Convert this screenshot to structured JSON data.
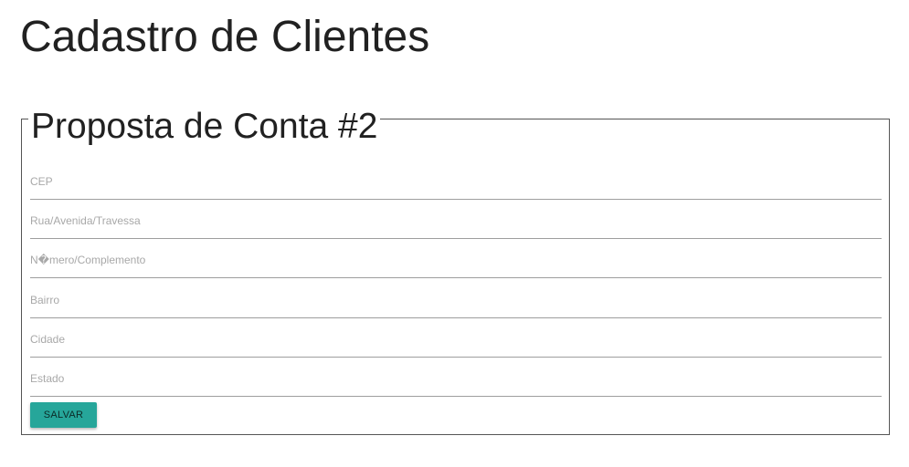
{
  "page": {
    "title": "Cadastro de Clientes"
  },
  "form": {
    "legend": "Proposta de Conta #2",
    "fields": [
      {
        "placeholder": "CEP",
        "value": ""
      },
      {
        "placeholder": "Rua/Avenida/Travessa",
        "value": ""
      },
      {
        "placeholder": "N�mero/Complemento",
        "value": ""
      },
      {
        "placeholder": "Bairro",
        "value": ""
      },
      {
        "placeholder": "Cidade",
        "value": ""
      },
      {
        "placeholder": "Estado",
        "value": ""
      }
    ],
    "save_label": "SALVAR"
  },
  "colors": {
    "accent": "#26a69a",
    "text": "#212121",
    "placeholder": "#a8a8a8",
    "field_underline": "#9e9e9e",
    "box_border": "#555555"
  }
}
